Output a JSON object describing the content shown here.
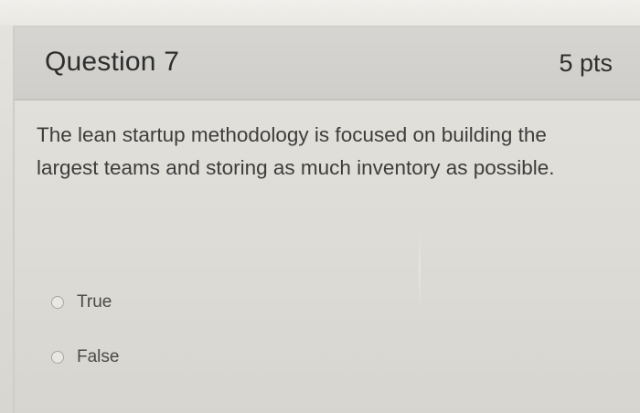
{
  "question": {
    "title": "Question 7",
    "points": "5 pts",
    "text": "The lean startup methodology is focused on building the largest teams and storing as much inventory as possible."
  },
  "answers": [
    {
      "label": "True"
    },
    {
      "label": "False"
    }
  ]
}
